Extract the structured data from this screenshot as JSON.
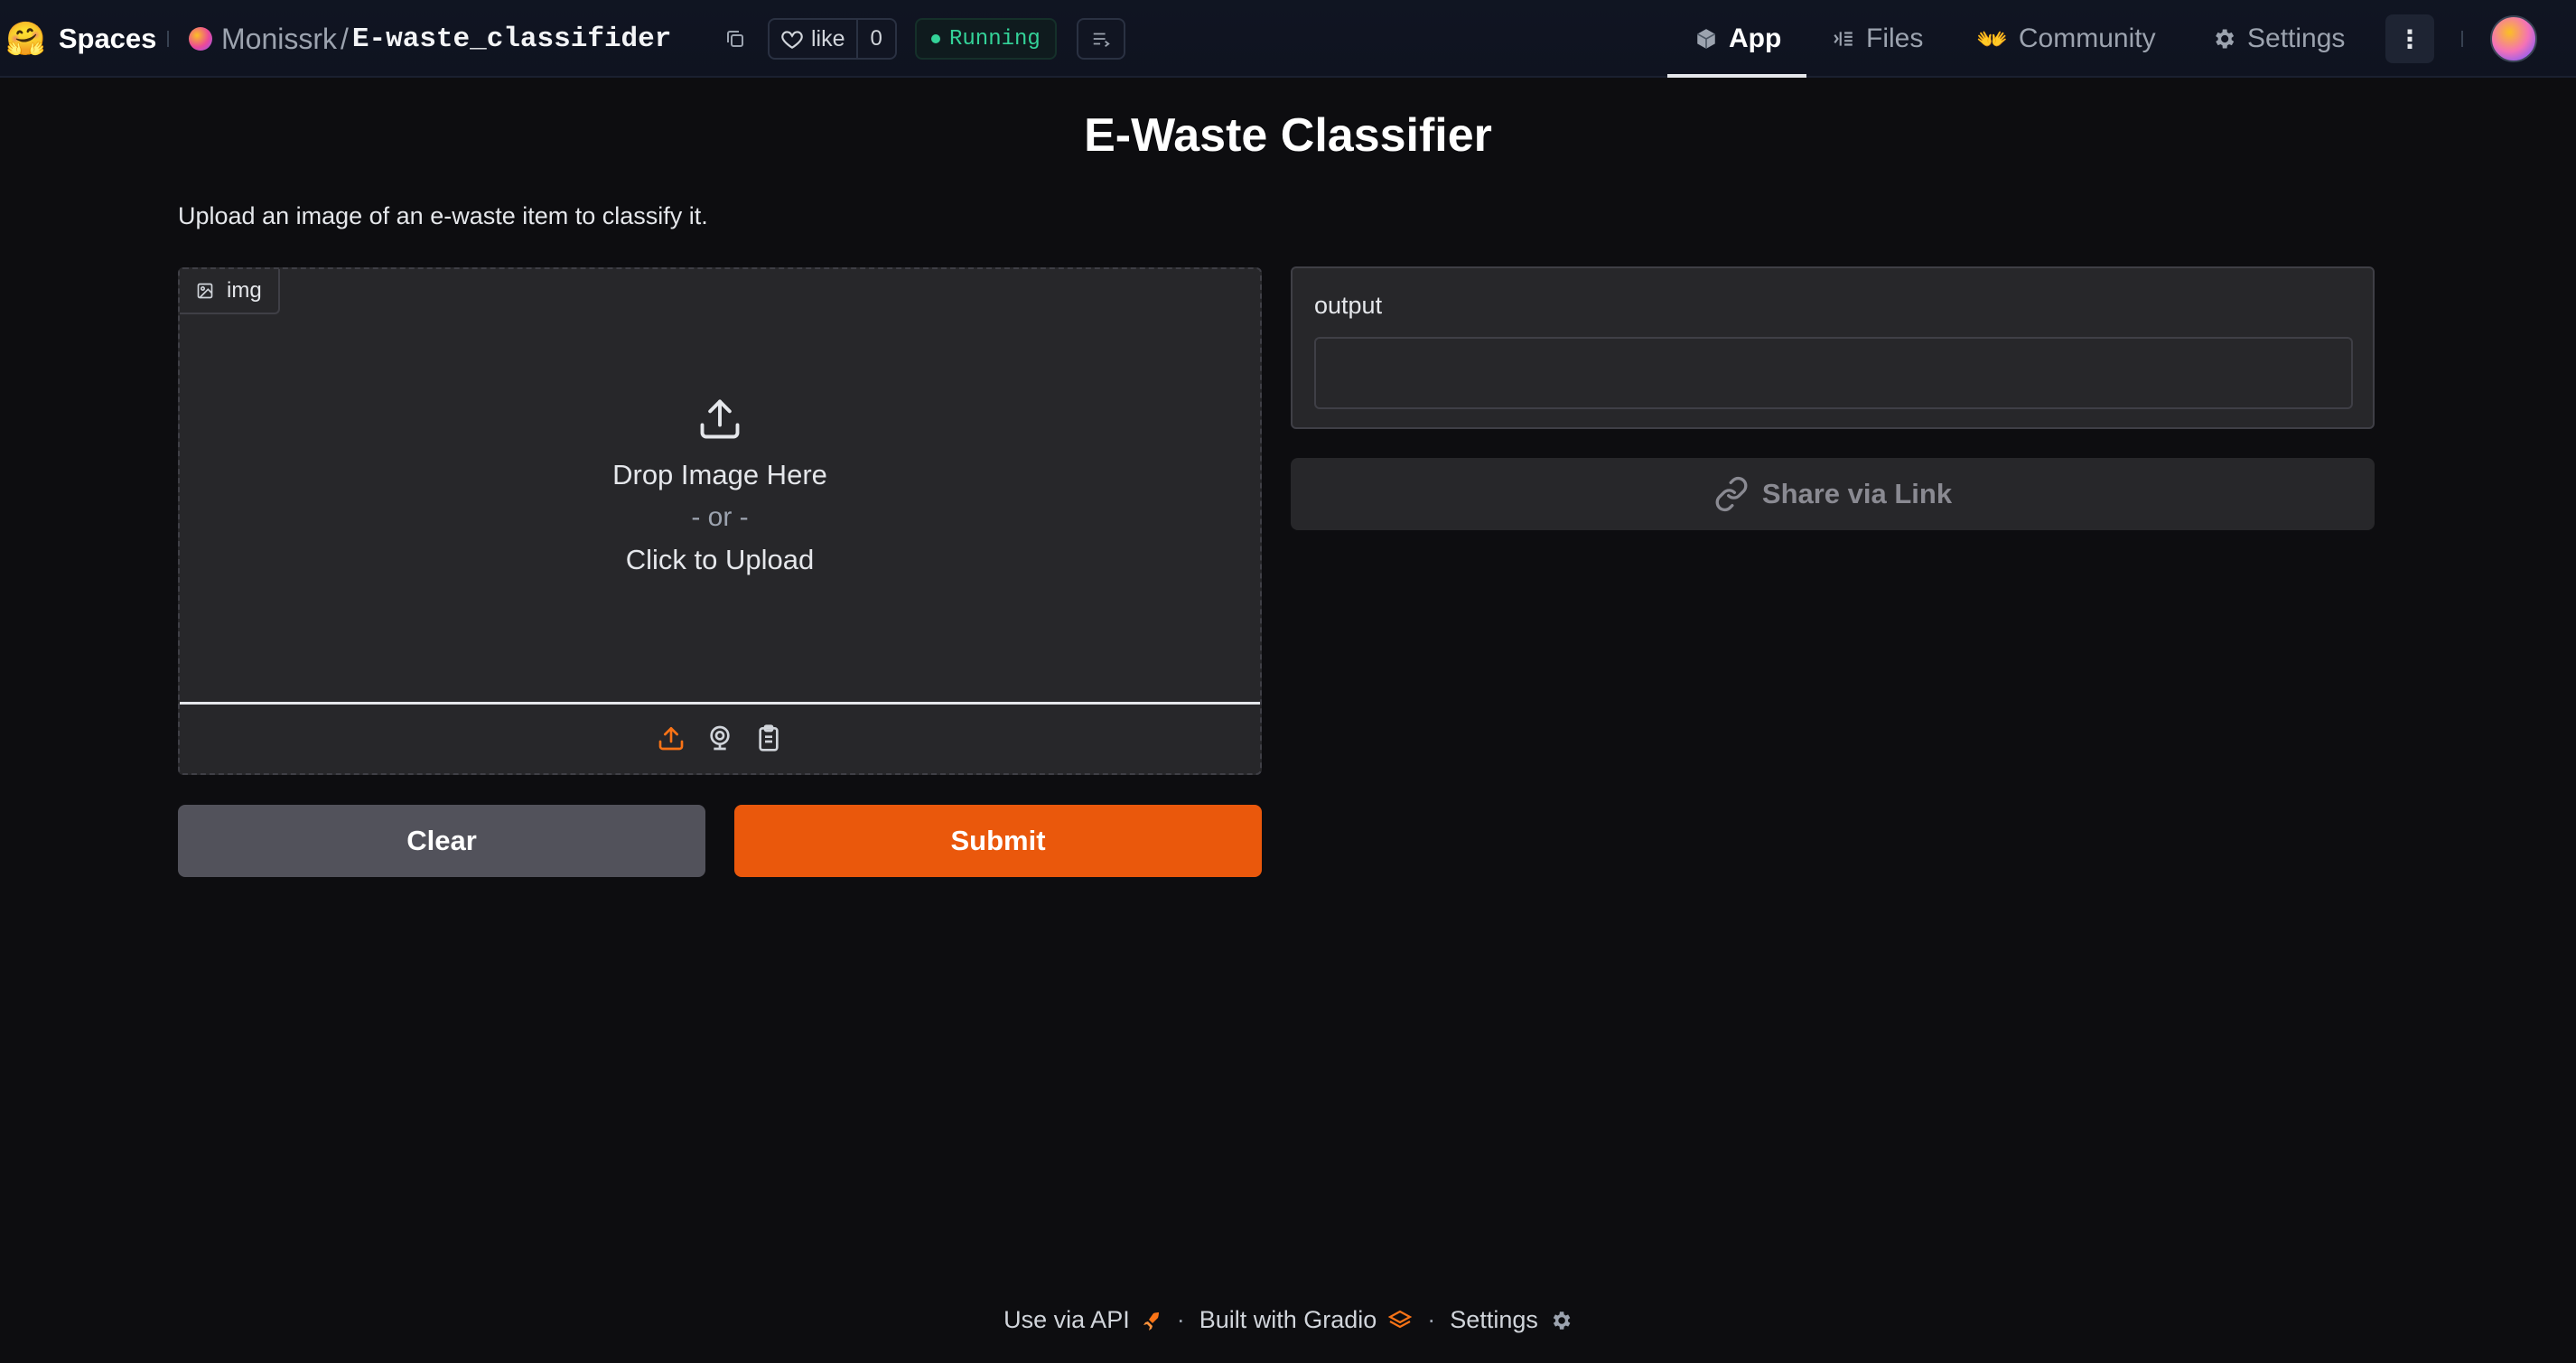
{
  "header": {
    "logo_emoji": "🤗",
    "spaces_label": "Spaces",
    "owner": "Monissrk",
    "separator": "/",
    "repo": "E-waste_classifider",
    "like_label": "like",
    "like_count": "0",
    "status": "Running",
    "nav": [
      {
        "label": "App",
        "icon": "cube-icon",
        "active": true
      },
      {
        "label": "Files",
        "icon": "files-icon",
        "active": false
      },
      {
        "label": "Community",
        "icon": "hand-wave-icon",
        "active": false
      },
      {
        "label": "Settings",
        "icon": "gear-icon",
        "active": false
      }
    ]
  },
  "app": {
    "title": "E-Waste Classifier",
    "description": "Upload an image of an e-waste item to classify it.",
    "input": {
      "label": "img",
      "drop_text": "Drop Image Here",
      "or_text": "- or -",
      "click_text": "Click to Upload",
      "sources": [
        "upload-icon",
        "webcam-icon",
        "clipboard-icon"
      ]
    },
    "clear_label": "Clear",
    "submit_label": "Submit",
    "output": {
      "label": "output",
      "value": ""
    },
    "share_label": "Share via Link"
  },
  "footer": {
    "api": "Use via API",
    "built": "Built with Gradio",
    "settings": "Settings",
    "dot": "·"
  },
  "colors": {
    "accent": "#ea580c",
    "status": "#34d399",
    "background": "#0d0d10",
    "panel": "#27272a"
  }
}
